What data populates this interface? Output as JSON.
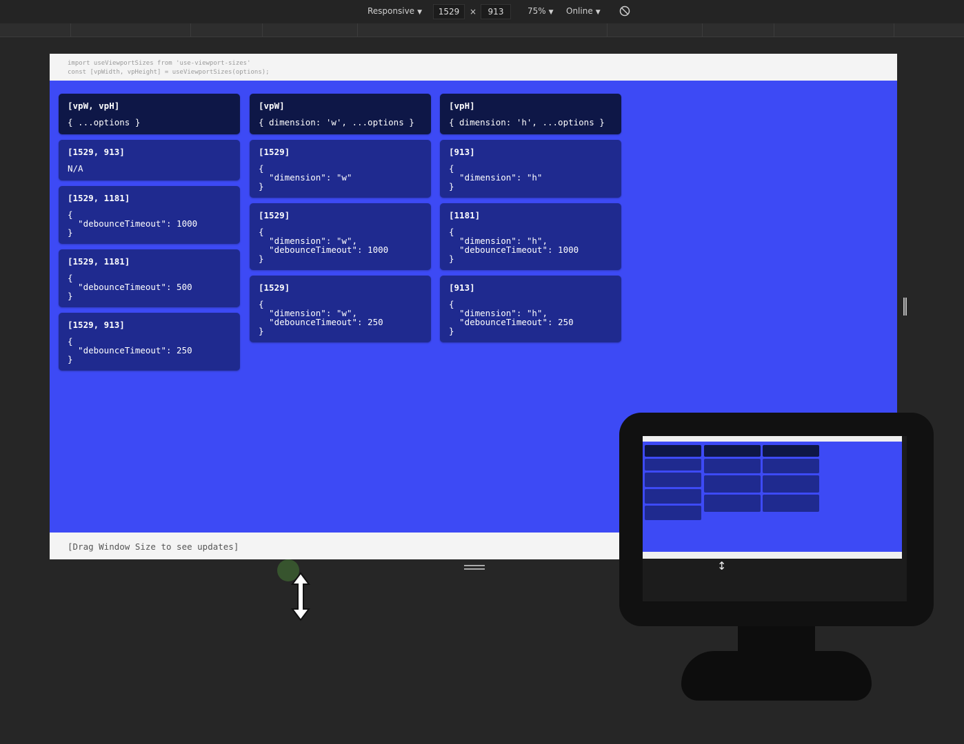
{
  "toolbar": {
    "device_label": "Responsive",
    "width_value": "1529",
    "times_sign": "×",
    "height_value": "913",
    "zoom_label": "75%",
    "network_label": "Online",
    "rotate_icon": "rotate-icon"
  },
  "code_header": {
    "line1": "import useViewportSizes from 'use-viewport-sizes'",
    "line2": "const [vpWidth, vpHeight] = useViewportSizes(options);"
  },
  "columns": [
    {
      "head": {
        "title": "[vpW, vpH]",
        "body": "{ ...options }"
      },
      "cards": [
        {
          "title": "[1529, 913]",
          "body": "N/A",
          "plain": true
        },
        {
          "title": "[1529, 1181]",
          "body": "{\n  \"debounceTimeout\": 1000\n}"
        },
        {
          "title": "[1529, 1181]",
          "body": "{\n  \"debounceTimeout\": 500\n}"
        },
        {
          "title": "[1529, 913]",
          "body": "{\n  \"debounceTimeout\": 250\n}"
        }
      ]
    },
    {
      "head": {
        "title": "[vpW]",
        "body": "{ dimension: 'w', ...options }"
      },
      "cards": [
        {
          "title": "[1529]",
          "body": "{\n  \"dimension\": \"w\"\n}"
        },
        {
          "title": "[1529]",
          "body": "{\n  \"dimension\": \"w\",\n  \"debounceTimeout\": 1000\n}"
        },
        {
          "title": "[1529]",
          "body": "{\n  \"dimension\": \"w\",\n  \"debounceTimeout\": 250\n}"
        }
      ]
    },
    {
      "head": {
        "title": "[vpH]",
        "body": "{ dimension: 'h', ...options }"
      },
      "cards": [
        {
          "title": "[913]",
          "body": "{\n  \"dimension\": \"h\"\n}"
        },
        {
          "title": "[1181]",
          "body": "{\n  \"dimension\": \"h\",\n  \"debounceTimeout\": 1000\n}"
        },
        {
          "title": "[913]",
          "body": "{\n  \"dimension\": \"h\",\n  \"debounceTimeout\": 250\n}"
        }
      ]
    }
  ],
  "footer": {
    "hint": "[Drag Window Size to see updates]"
  },
  "colors": {
    "viewport_bg": "#3d4af5",
    "card_bg": "#1f2a8f",
    "head_card_bg": "#0e1747",
    "devtools_bg": "#262626"
  }
}
